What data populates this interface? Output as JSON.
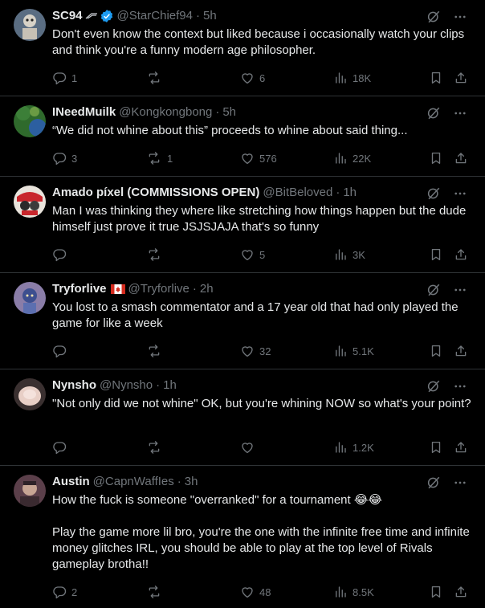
{
  "replies": [
    {
      "name": "SC94",
      "handle": "@StarChief94",
      "sep": "·",
      "time": "5h",
      "text": "Don't even know the context but liked because i occasionally watch your clips and think you're a funny modern age philosopher.",
      "replies": "1",
      "reposts": "",
      "likes": "6",
      "views": "18K",
      "verified": true
    },
    {
      "name": "INeedMuilk",
      "handle": "@Kongkongbong",
      "sep": "·",
      "time": "5h",
      "text": "“We did not whine about this” proceeds to whine about said thing...",
      "replies": "3",
      "reposts": "1",
      "likes": "576",
      "views": "22K"
    },
    {
      "name": "Amado píxel (COMMISSIONS OPEN)",
      "handle": "@BitBeloved",
      "sep": "·",
      "time": "1h",
      "text": "Man I was thinking they where like stretching how things happen but the dude himself just prove it true JSJSJAJA that's so funny",
      "replies": "",
      "reposts": "",
      "likes": "5",
      "views": "3K"
    },
    {
      "name": "Tryforlive",
      "handle": "@Tryforlive",
      "sep": "·",
      "time": "2h",
      "text": "You lost to a smash commentator and a 17 year old that had only played the game for like a week",
      "replies": "",
      "reposts": "",
      "likes": "32",
      "views": "5.1K",
      "flag": "canada-flag"
    },
    {
      "name": "Nynsho",
      "handle": "@Nynsho",
      "sep": "·",
      "time": "1h",
      "text": "\"Not only did we not whine\" OK, but you're whining NOW so what's your point?",
      "replies": "",
      "reposts": "",
      "likes": "",
      "views": "1.2K"
    },
    {
      "name": "Austin",
      "handle": "@CapnWaffIes",
      "sep": "·",
      "time": "3h",
      "text": "How the fuck is someone \"overranked\" for a tournament 😂😂\n\nPlay the game more lil bro, you're the one with the infinite free time and infinite money glitches IRL, you should be able to play at the top level of Rivals gameplay brotha!!",
      "replies": "2",
      "reposts": "",
      "likes": "48",
      "views": "8.5K"
    }
  ],
  "colors": {
    "background": "#000000",
    "text": "#e7e9ea",
    "muted": "#71767b",
    "divider": "#2f3336",
    "verified": "#1d9bf0"
  },
  "icons": [
    "grok-icon",
    "more-icon",
    "reply-icon",
    "repost-icon",
    "like-icon",
    "views-icon",
    "bookmark-icon",
    "share-icon",
    "verified-icon"
  ]
}
